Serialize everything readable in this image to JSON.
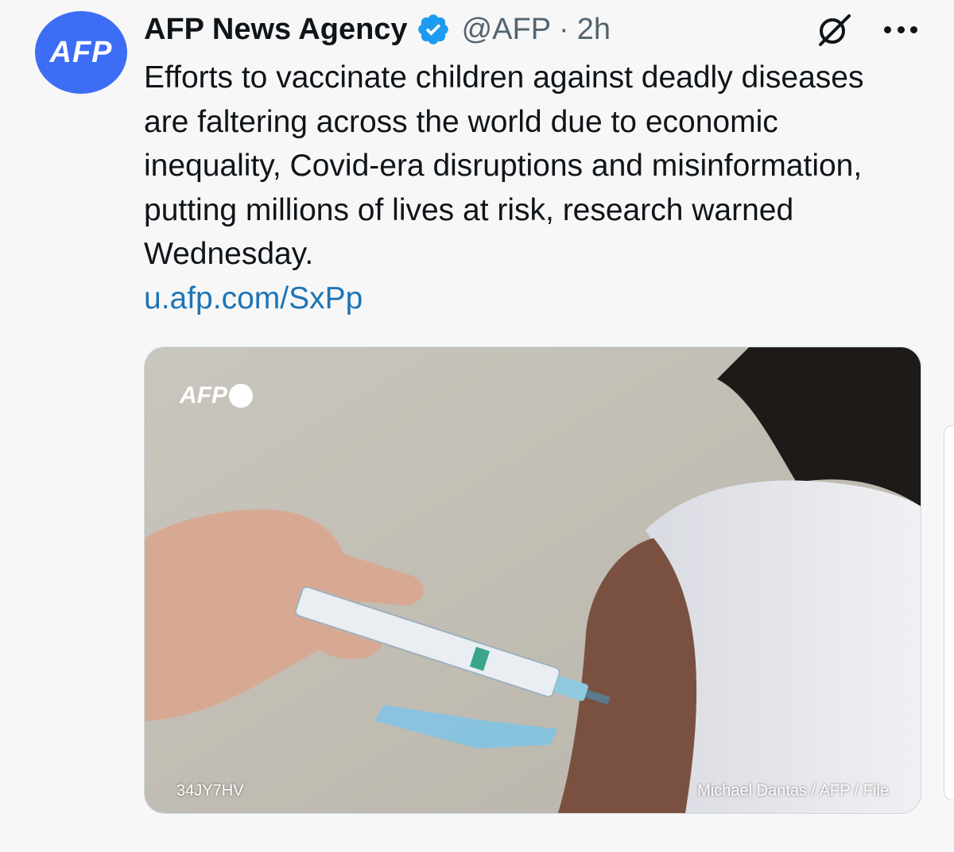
{
  "tweet": {
    "author_name": "AFP News Agency",
    "handle": "@AFP",
    "separator": "·",
    "time": "2h",
    "avatar_text": "AFP",
    "body": "Efforts to vaccinate children against deadly diseases are faltering across the world due to economic inequality, Covid-era disruptions and misinformation, putting millions of lives at risk, research warned Wednesday.",
    "link": "u.afp.com/SxPp",
    "media": {
      "watermark": "AFP",
      "photo_id": "34JY7HV",
      "credit": "Michael Dantas / AFP / File"
    }
  },
  "icons": {
    "verified": "verified-badge-icon",
    "grok": "grok-icon",
    "more": "more-options-icon"
  },
  "colors": {
    "avatar": "#3d6df5",
    "verified": "#1d9bf0",
    "link": "#1d74b6",
    "handle": "#536471"
  }
}
